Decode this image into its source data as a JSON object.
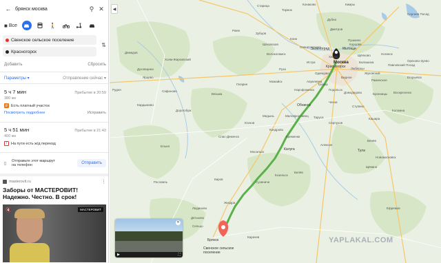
{
  "search": {
    "query": "брянск москва"
  },
  "modes": {
    "all_label": "Все"
  },
  "route_inputs": {
    "from": "Свенское сельское поселение",
    "to": "Красногорск",
    "from_color": "#e0352b",
    "to_color": "#222222"
  },
  "actions": {
    "add": "Добавить",
    "reset": "Сбросить"
  },
  "params": {
    "label": "Параметры",
    "departure": "Отправление сейчас"
  },
  "routes": [
    {
      "time": "5 ч 7 мин",
      "arrival": "Прибытие в 20:59",
      "distance": "380 км",
      "note": "Есть платный участок",
      "link_more": "Посмотреть подробнее",
      "link_edit": "Исправить"
    },
    {
      "time": "5 ч 51 мин",
      "arrival": "Прибытие в 21:43",
      "distance": "400 км",
      "note": "На пути есть ж/д переезд"
    }
  ],
  "send": {
    "text_line1": "Отправьте этот маршрут",
    "text_line2": "на телефон",
    "button": "Отправить"
  },
  "ad": {
    "source": "masterovit.ru",
    "headline_line1": "Заборы от МАСТЕРОВИТ!",
    "headline_line2": "Надежно. Честно. В срок!",
    "brand": "МАСТЕРОВИТ"
  },
  "map": {
    "labels": [
      "Старица",
      "Конаково",
      "Сергиев Посад",
      "Кимры",
      "Зеленоград",
      "Мытищи",
      "Красногорск",
      "Москва",
      "Химки",
      "Щёлково",
      "Балашиха",
      "Люберцы",
      "Подольск",
      "Нарофоминск",
      "Обнинск",
      "Серпухов",
      "Малоярославец",
      "Калуга",
      "Алексин",
      "Тула",
      "Кондрово",
      "Людиново",
      "Жиздра",
      "Брянск",
      "Карачев",
      "Сухиничи",
      "Козельск",
      "Белёв",
      "Мосальск",
      "Киров",
      "Рославль",
      "Вязьма",
      "Сафоново",
      "Ярцево",
      "Дорогобуж",
      "Ельня",
      "Гагарин",
      "Можайск",
      "Руза",
      "Истра",
      "Волоколамск",
      "Ржев",
      "Зубцов",
      "Шаховская",
      "Торжок",
      "Дятьково",
      "Сельцо",
      "Новомосковск",
      "Щёкино",
      "Ефремов",
      "Венёв",
      "Ступино",
      "Кашира",
      "Коломна",
      "Воскресенск",
      "Раменское",
      "Жуковский",
      "Ногинск",
      "Павловский Посад",
      "Орехово-Зуево",
      "Чехов",
      "Таруса",
      "Медынь",
      "Юхнов",
      "Спас-Деменск",
      "Кременки",
      "Кардымово",
      "Холм-Жирковский",
      "Рудня",
      "Демидов",
      "Духовщина",
      "Клин",
      "Дмитров",
      "Дубна",
      "Солнечногорск",
      "Пушкино",
      "Королёв",
      "Одинцово",
      "Апрелевка",
      "Троицк",
      "Видное",
      "Домодедово",
      "Бронницы",
      "Егорьевск"
    ],
    "destination_label": "Свенское сельское поселение",
    "route_color": "#5ab04a"
  },
  "watermark": "YAPLAKAL.COM"
}
